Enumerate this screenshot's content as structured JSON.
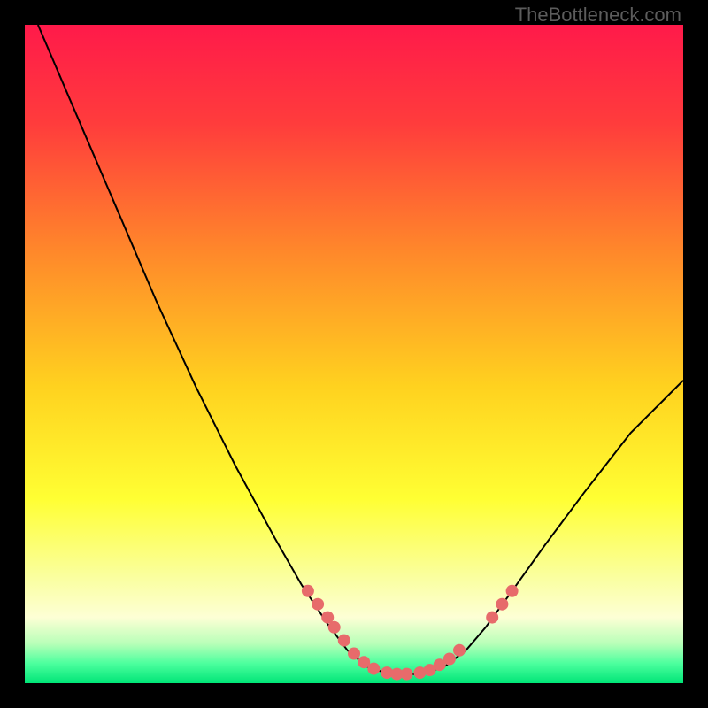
{
  "watermark": "TheBottleneck.com",
  "chart_data": {
    "type": "line",
    "title": "",
    "xlabel": "",
    "ylabel": "",
    "xlim": [
      0,
      100
    ],
    "ylim": [
      0,
      100
    ],
    "background_gradient": {
      "stops": [
        {
          "offset": 0.0,
          "color": "#ff1a4a"
        },
        {
          "offset": 0.15,
          "color": "#ff3c3c"
        },
        {
          "offset": 0.35,
          "color": "#ff8a2a"
        },
        {
          "offset": 0.55,
          "color": "#ffd21f"
        },
        {
          "offset": 0.72,
          "color": "#ffff33"
        },
        {
          "offset": 0.84,
          "color": "#faffa0"
        },
        {
          "offset": 0.9,
          "color": "#fdffd5"
        },
        {
          "offset": 0.94,
          "color": "#b8ffb8"
        },
        {
          "offset": 0.97,
          "color": "#4cff9e"
        },
        {
          "offset": 1.0,
          "color": "#00e577"
        }
      ]
    },
    "series": [
      {
        "name": "bottleneck-curve",
        "color": "#000000",
        "width": 2,
        "points": [
          {
            "x": 2,
            "y": 100
          },
          {
            "x": 8,
            "y": 86
          },
          {
            "x": 14,
            "y": 72
          },
          {
            "x": 20,
            "y": 58
          },
          {
            "x": 26,
            "y": 45
          },
          {
            "x": 32,
            "y": 33
          },
          {
            "x": 38,
            "y": 22
          },
          {
            "x": 42,
            "y": 15
          },
          {
            "x": 46,
            "y": 9
          },
          {
            "x": 49,
            "y": 5
          },
          {
            "x": 52,
            "y": 2.5
          },
          {
            "x": 55,
            "y": 1.5
          },
          {
            "x": 58,
            "y": 1.3
          },
          {
            "x": 61,
            "y": 1.5
          },
          {
            "x": 64,
            "y": 2.7
          },
          {
            "x": 67,
            "y": 5
          },
          {
            "x": 70,
            "y": 8.5
          },
          {
            "x": 74,
            "y": 14
          },
          {
            "x": 79,
            "y": 21
          },
          {
            "x": 85,
            "y": 29
          },
          {
            "x": 92,
            "y": 38
          },
          {
            "x": 100,
            "y": 46
          }
        ]
      }
    ],
    "markers": [
      {
        "name": "highlight-dots",
        "color": "#e76b6b",
        "radius": 7,
        "points": [
          {
            "x": 43,
            "y": 14
          },
          {
            "x": 44.5,
            "y": 12
          },
          {
            "x": 46,
            "y": 10
          },
          {
            "x": 47,
            "y": 8.5
          },
          {
            "x": 48.5,
            "y": 6.5
          },
          {
            "x": 50,
            "y": 4.5
          },
          {
            "x": 51.5,
            "y": 3.2
          },
          {
            "x": 53,
            "y": 2.2
          },
          {
            "x": 55,
            "y": 1.6
          },
          {
            "x": 56.5,
            "y": 1.4
          },
          {
            "x": 58,
            "y": 1.4
          },
          {
            "x": 60,
            "y": 1.6
          },
          {
            "x": 61.5,
            "y": 2
          },
          {
            "x": 63,
            "y": 2.8
          },
          {
            "x": 64.5,
            "y": 3.7
          },
          {
            "x": 66,
            "y": 5
          },
          {
            "x": 71,
            "y": 10
          },
          {
            "x": 72.5,
            "y": 12
          },
          {
            "x": 74,
            "y": 14
          }
        ]
      }
    ]
  }
}
